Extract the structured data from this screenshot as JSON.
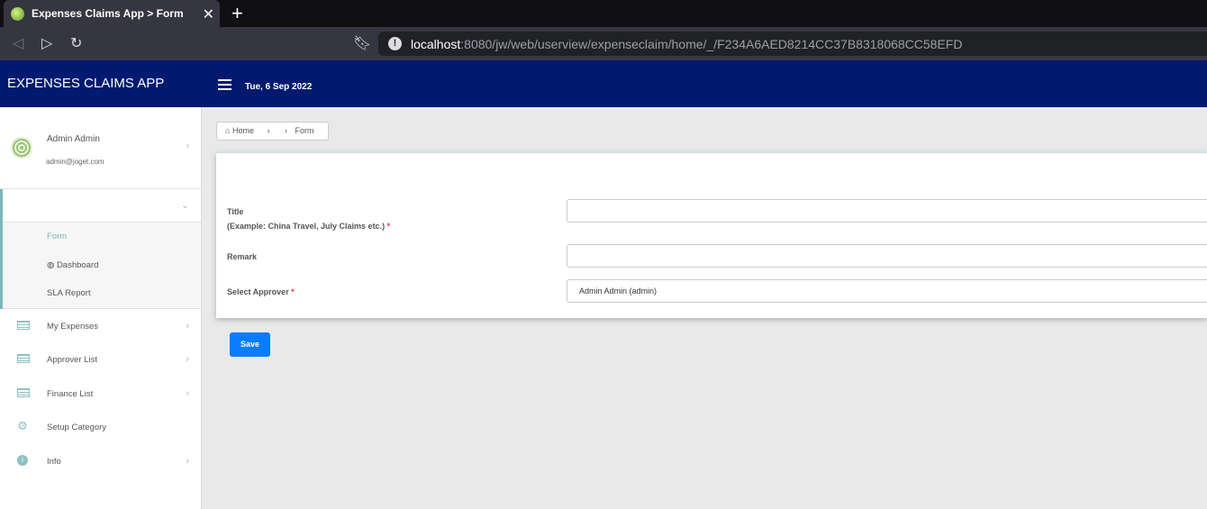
{
  "browser": {
    "tab_title": "Expenses Claims App > Form",
    "url_host": "localhost",
    "url_rest": ":8080/jw/web/userview/expenseclaim/home/_/F234A6AED8214CC37B8318068CC58EFD"
  },
  "header": {
    "app_title": "EXPENSES CLAIMS APP",
    "date": "Tue, 6 Sep 2022"
  },
  "profile": {
    "name": "Admin Admin",
    "email": "admin@joget.com"
  },
  "sidebar": {
    "sub_items": [
      {
        "label": "Form"
      },
      {
        "label": "Dashboard"
      },
      {
        "label": "SLA Report"
      }
    ],
    "items": [
      {
        "label": "My Expenses"
      },
      {
        "label": "Approver List"
      },
      {
        "label": "Finance List"
      },
      {
        "label": "Setup Category"
      },
      {
        "label": "Info"
      }
    ]
  },
  "breadcrumb": {
    "home": "Home",
    "current": "Form"
  },
  "form": {
    "title_label": "Title",
    "title_hint": "(Example: China Travel, July Claims etc.)",
    "title_value": "",
    "remark_label": "Remark",
    "remark_value": "",
    "approver_label": "Select Approver",
    "approver_value": "Admin Admin (admin)",
    "required_mark": "*",
    "save_label": "Save"
  }
}
